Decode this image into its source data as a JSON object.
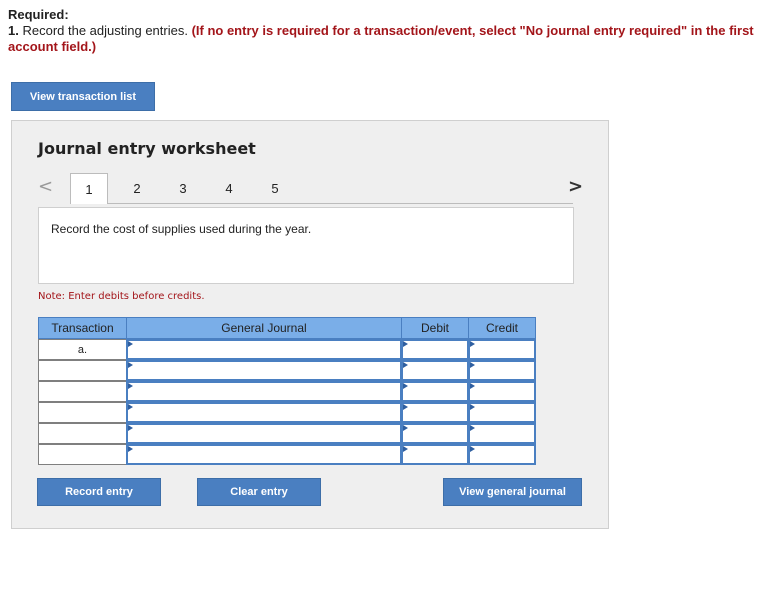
{
  "header": {
    "required": "Required:",
    "instruction_num": "1.",
    "instruction_text": "Record the adjusting entries.",
    "instruction_note": "(If no entry is required for a transaction/event, select \"No journal entry required\" in the first account field.)"
  },
  "buttons": {
    "view_transaction_list": "View transaction list",
    "record_entry": "Record entry",
    "clear_entry": "Clear entry",
    "view_general_journal": "View general journal"
  },
  "worksheet": {
    "title": "Journal entry worksheet",
    "tabs": [
      "1",
      "2",
      "3",
      "4",
      "5"
    ],
    "active_tab": "1",
    "prev_arrow": "<",
    "next_arrow": ">",
    "description": "Record the cost of supplies used during the year.",
    "note": "Note: Enter debits before credits."
  },
  "table": {
    "headers": {
      "transaction": "Transaction",
      "general_journal": "General Journal",
      "debit": "Debit",
      "credit": "Credit"
    },
    "rows": [
      {
        "transaction": "a."
      },
      {
        "transaction": ""
      },
      {
        "transaction": ""
      },
      {
        "transaction": ""
      },
      {
        "transaction": ""
      },
      {
        "transaction": ""
      }
    ]
  },
  "colors": {
    "button": "#4a7fc1",
    "header": "#7aaee8",
    "accent_red": "#a3151a"
  }
}
